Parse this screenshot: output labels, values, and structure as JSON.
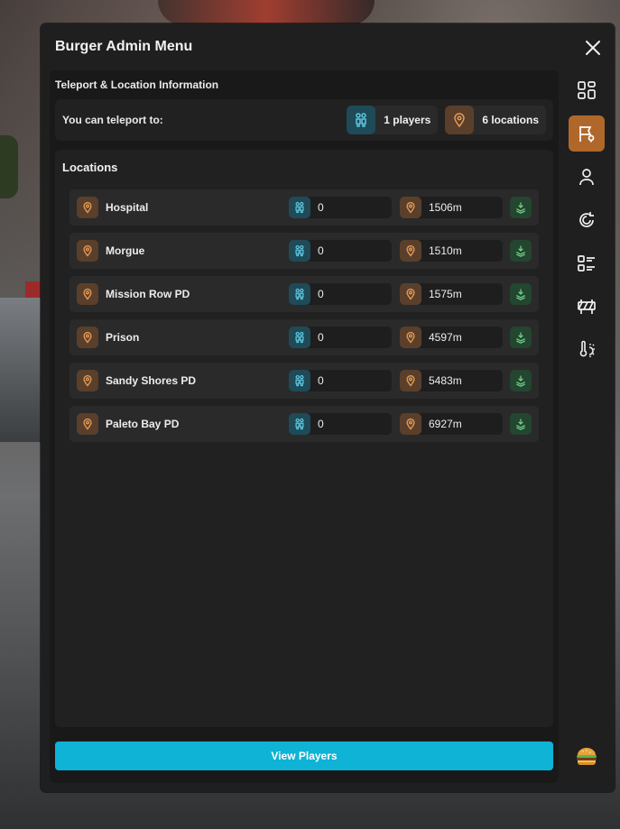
{
  "window": {
    "title": "Burger Admin Menu"
  },
  "teleport": {
    "section_label": "Teleport & Location Information",
    "prompt": "You can teleport to:",
    "players_chip": "1 players",
    "locations_chip": "6 locations"
  },
  "locations": {
    "title": "Locations",
    "rows": [
      {
        "name": "Hospital",
        "players": "0",
        "distance": "1506m"
      },
      {
        "name": "Morgue",
        "players": "0",
        "distance": "1510m"
      },
      {
        "name": "Mission Row PD",
        "players": "0",
        "distance": "1575m"
      },
      {
        "name": "Prison",
        "players": "0",
        "distance": "4597m"
      },
      {
        "name": "Sandy Shores PD",
        "players": "0",
        "distance": "5483m"
      },
      {
        "name": "Paleto Bay PD",
        "players": "0",
        "distance": "6927m"
      }
    ]
  },
  "footer": {
    "view_players_label": "View Players"
  },
  "sidebar": {
    "items": [
      {
        "icon": "dashboard-icon",
        "active": false
      },
      {
        "icon": "flag-location-icon",
        "active": true
      },
      {
        "icon": "user-icon",
        "active": false
      },
      {
        "icon": "refresh-circle-icon",
        "active": false
      },
      {
        "icon": "list-icon",
        "active": false
      },
      {
        "icon": "barrier-icon",
        "active": false
      },
      {
        "icon": "weather-icon",
        "active": false
      }
    ],
    "logo": "burger-logo-icon"
  },
  "colors": {
    "accent_active": "#b0682a",
    "button_primary": "#0fb3d6",
    "teal_icon": "#5ec6df",
    "brown_icon": "#e49a55",
    "green_icon": "#6fd38c"
  }
}
